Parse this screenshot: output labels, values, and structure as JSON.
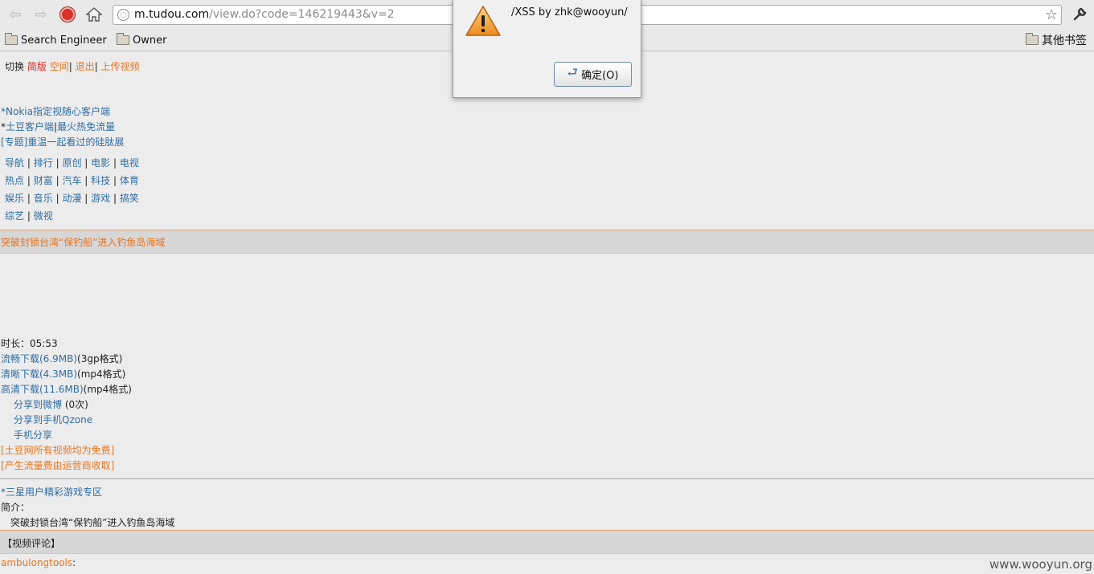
{
  "browser": {
    "url_host": "m.tudou.com",
    "url_path": "/view.do?code=146219443&v=2",
    "bookmarks": [
      "Search Engineer",
      "Owner"
    ],
    "other_bookmarks": "其他书签"
  },
  "alert": {
    "message": "/XSS by zhk@wooyun/",
    "ok_label": "确定(O)"
  },
  "page": {
    "top_nav": {
      "switch": "切换",
      "simple": "简版",
      "space": "空间",
      "logout": "退出",
      "upload": "上传视频"
    },
    "promo_nokia": "*Nokia指定视随心客户端",
    "promo_client_prefix": "*",
    "promo_client": "土豆客户端",
    "promo_hot": "最火热免流量",
    "promo_topic": "[专题]重温一起看过的硅肽展",
    "categories": [
      [
        "导航",
        "排行",
        "原创",
        "电影",
        "电视"
      ],
      [
        "热点",
        "财富",
        "汽车",
        "科技",
        "体育"
      ],
      [
        "娱乐",
        "音乐",
        "动漫",
        "游戏",
        "搞笑"
      ],
      [
        "综艺",
        "微视"
      ]
    ],
    "headline": "突破封锁台湾“保钓船”进入钓鱼岛海域",
    "duration": "时长：05:53",
    "downloads": [
      {
        "link": "流畅下载(6.9MB)",
        "format": "(3gp格式)"
      },
      {
        "link": "清晰下载(4.3MB)",
        "format": "(mp4格式)"
      },
      {
        "link": "高清下载(11.6MB)",
        "format": "(mp4格式)"
      }
    ],
    "share_weibo": "分享到微博",
    "share_weibo_count": " (0次)",
    "share_qzone": "分享到手机Qzone",
    "share_mobile": "手机分享",
    "free_notice": "[土豆网所有视频均为免费]",
    "fee_notice": "[产生流量费由运营商收取]",
    "samsung_promo": "*三星用户精彩游戏专区",
    "intro_label": "简介：",
    "intro_text": "突破封锁台湾“保钓船”进入钓鱼岛海域",
    "comments_title": "【视频评论】",
    "commenter": "ambulongtools",
    "commenter_colon": ":",
    "watermark": "www.wooyun.org"
  }
}
